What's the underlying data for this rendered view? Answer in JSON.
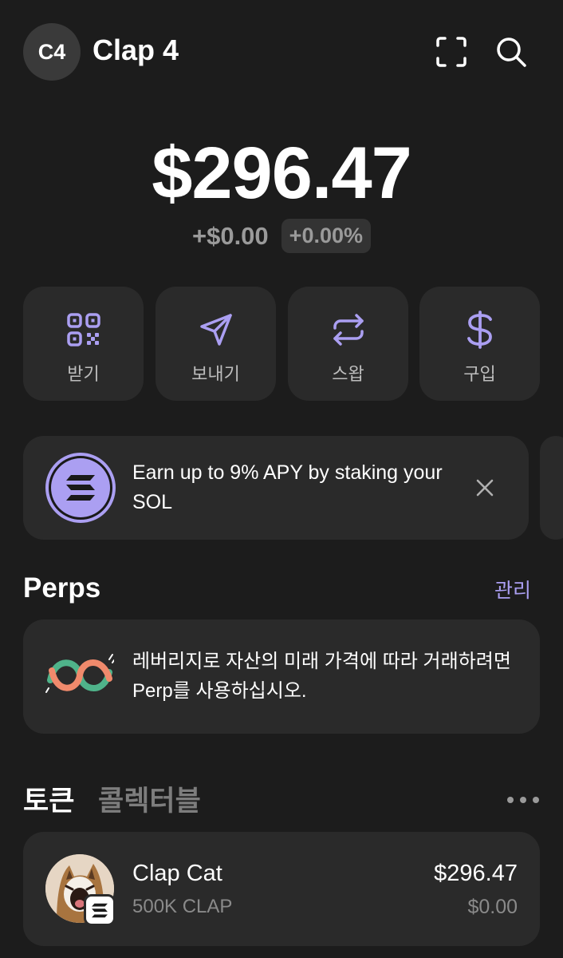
{
  "header": {
    "avatar_initials": "C4",
    "account_name": "Clap 4",
    "scan_icon": "scan-icon",
    "search_icon": "search-icon"
  },
  "balance": {
    "total": "$296.47",
    "change_amount": "+$0.00",
    "change_percent": "+0.00%"
  },
  "actions": [
    {
      "label": "받기",
      "icon": "qr-code-icon"
    },
    {
      "label": "보내기",
      "icon": "send-icon"
    },
    {
      "label": "스왑",
      "icon": "swap-icon"
    },
    {
      "label": "구입",
      "icon": "dollar-icon"
    }
  ],
  "promo": {
    "text": "Earn up to 9% APY by staking your SOL",
    "icon": "solana-icon",
    "close_icon": "close-icon"
  },
  "perps": {
    "title": "Perps",
    "manage_label": "관리",
    "description": "레버리지로 자산의 미래 가격에 따라 거래하려면 Perp를 사용하십시오.",
    "icon": "perps-logo-icon"
  },
  "tabs": {
    "active": "토큰",
    "inactive": "콜렉터블",
    "more_icon": "more-icon"
  },
  "tokens": [
    {
      "name": "Clap Cat",
      "amount": "500K CLAP",
      "value": "$296.47",
      "change": "$0.00",
      "chain_icon": "solana-chain-icon"
    }
  ],
  "colors": {
    "background": "#1c1c1c",
    "card": "#2a2a2a",
    "accent": "#ab9ff2",
    "muted_text": "#8a8a8a"
  }
}
